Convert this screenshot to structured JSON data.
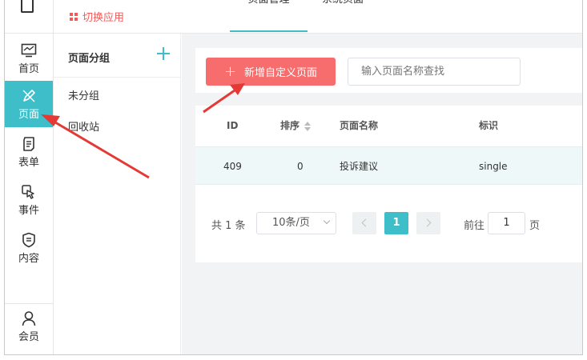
{
  "header": {
    "switch_label": "切换应用",
    "tabs": [
      {
        "label": "页面管理"
      },
      {
        "label": "系统页面"
      }
    ]
  },
  "nav": {
    "items": [
      {
        "label": "首页",
        "icon": "dashboard-icon"
      },
      {
        "label": "页面",
        "icon": "edit-pen-icon"
      },
      {
        "label": "表单",
        "icon": "form-icon"
      },
      {
        "label": "事件",
        "icon": "touch-icon"
      },
      {
        "label": "内容",
        "icon": "shield-doc-icon"
      }
    ],
    "bottom_label": "会员"
  },
  "groups": {
    "title": "页面分组",
    "items": [
      "未分组",
      "回收站"
    ]
  },
  "toolbar": {
    "add_label": "新增自定义页面",
    "search_placeholder": "输入页面名称查找"
  },
  "table": {
    "columns": [
      "ID",
      "排序",
      "页面名称",
      "标识"
    ],
    "rows": [
      {
        "id": "409",
        "order": "0",
        "name": "投诉建议",
        "key": "single"
      }
    ]
  },
  "pagination": {
    "total": "共 1 条",
    "page_size": "10条/页",
    "current_page": "1",
    "goto_label": "前往",
    "goto_value": "1",
    "page_unit": "页"
  },
  "colors": {
    "accent": "#3dbec8",
    "danger": "#f76c6c",
    "annotation": "#e53935"
  }
}
